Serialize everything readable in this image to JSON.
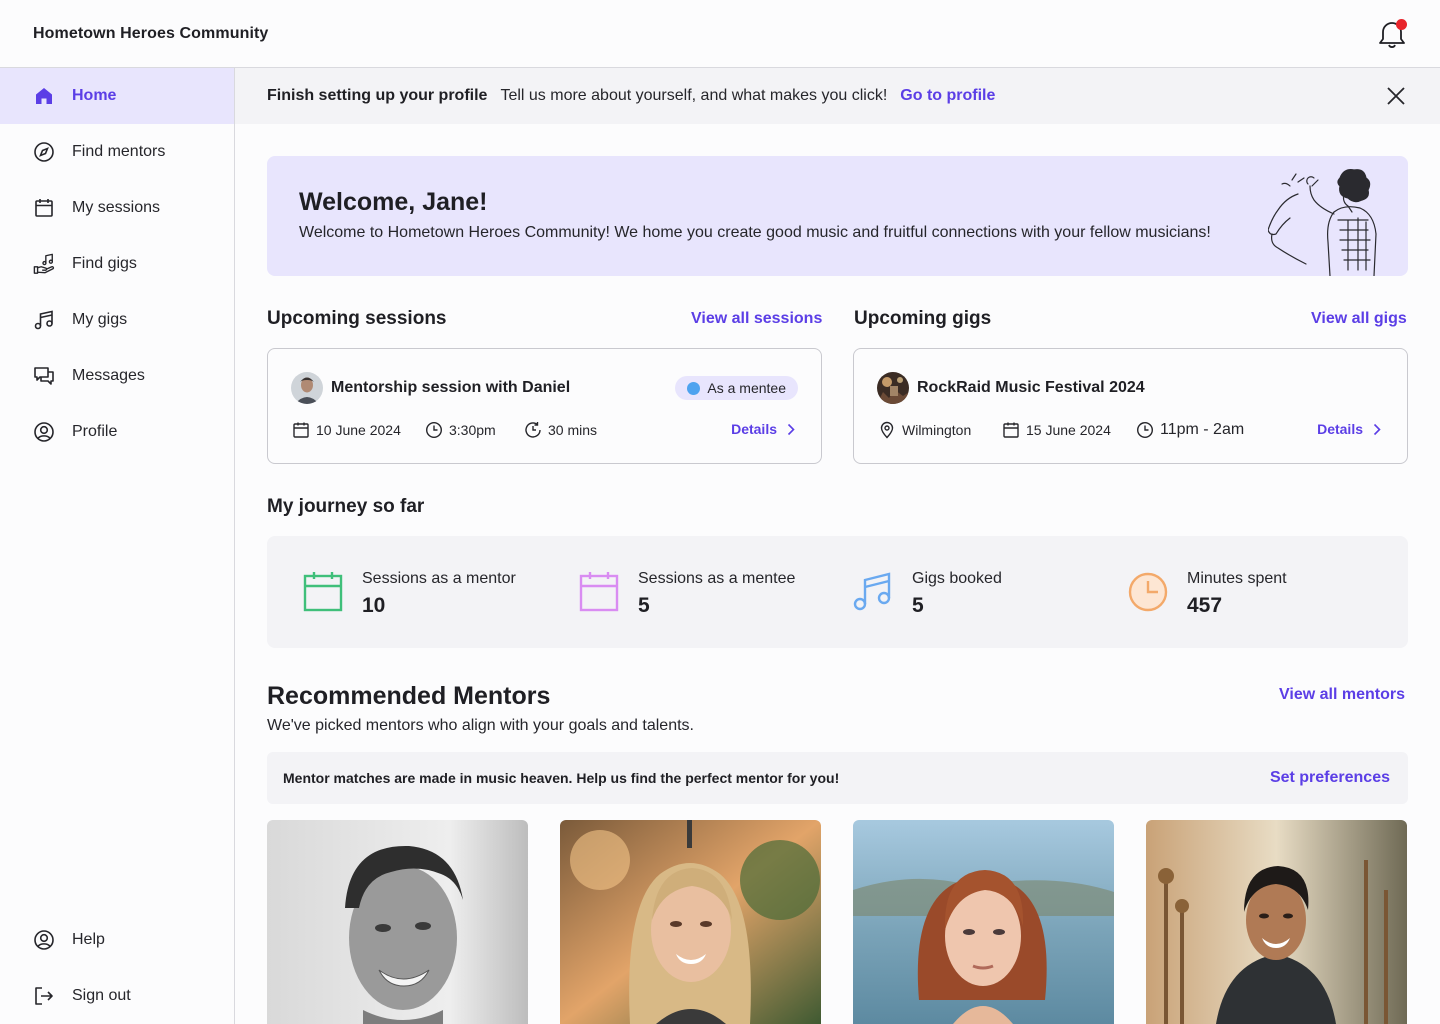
{
  "app": {
    "title": "Hometown Heroes Community"
  },
  "sidebar": {
    "items": [
      {
        "label": "Home",
        "icon": "home-icon"
      },
      {
        "label": "Find mentors",
        "icon": "compass-icon"
      },
      {
        "label": "My sessions",
        "icon": "calendar-icon"
      },
      {
        "label": "Find gigs",
        "icon": "hand-music-icon"
      },
      {
        "label": "My gigs",
        "icon": "music-note-icon"
      },
      {
        "label": "Messages",
        "icon": "chat-icon"
      },
      {
        "label": "Profile",
        "icon": "user-circle-icon"
      }
    ],
    "footer": [
      {
        "label": "Help",
        "icon": "help-icon"
      },
      {
        "label": "Sign out",
        "icon": "sign-out-icon"
      }
    ]
  },
  "profile_banner": {
    "title": "Finish setting up your profile",
    "text": "Tell us more about yourself, and what makes you click!",
    "link": "Go to profile"
  },
  "welcome": {
    "heading": "Welcome, Jane!",
    "message": "Welcome to Hometown Heroes Community!  We home you create good music and fruitful connections with your fellow musicians!"
  },
  "sessions": {
    "title": "Upcoming sessions",
    "link": "View all sessions",
    "card": {
      "title": "Mentorship session with Daniel",
      "badge": "As a mentee",
      "date": "10 June 2024",
      "time": "3:30pm",
      "duration": "30 mins",
      "details": "Details"
    }
  },
  "gigs": {
    "title": "Upcoming gigs",
    "link": "View all gigs",
    "card": {
      "title": "RockRaid Music Festival 2024",
      "location": "Wilmington",
      "date": "15 June 2024",
      "time": "11pm - 2am",
      "details": "Details"
    }
  },
  "journey": {
    "title": "My journey so far",
    "stats": [
      {
        "label": "Sessions as a mentor",
        "value": "10",
        "color": "#3fbf7a"
      },
      {
        "label": "Sessions as a mentee",
        "value": "5",
        "color": "#d98cf2"
      },
      {
        "label": "Gigs booked",
        "value": "5",
        "color": "#6aa9f0"
      },
      {
        "label": "Minutes spent",
        "value": "457",
        "color": "#f3a96a"
      }
    ]
  },
  "mentors": {
    "title": "Recommended Mentors",
    "subtitle": "We've picked mentors who align with your goals and talents.",
    "link": "View all mentors",
    "preferences_text": "Mentor matches are made in music heaven. Help us find the perfect mentor for you!",
    "preferences_link": "Set preferences"
  },
  "colors": {
    "accent": "#5b3ee6",
    "accent_light": "#e8e5fd",
    "notification": "#e8242b"
  }
}
